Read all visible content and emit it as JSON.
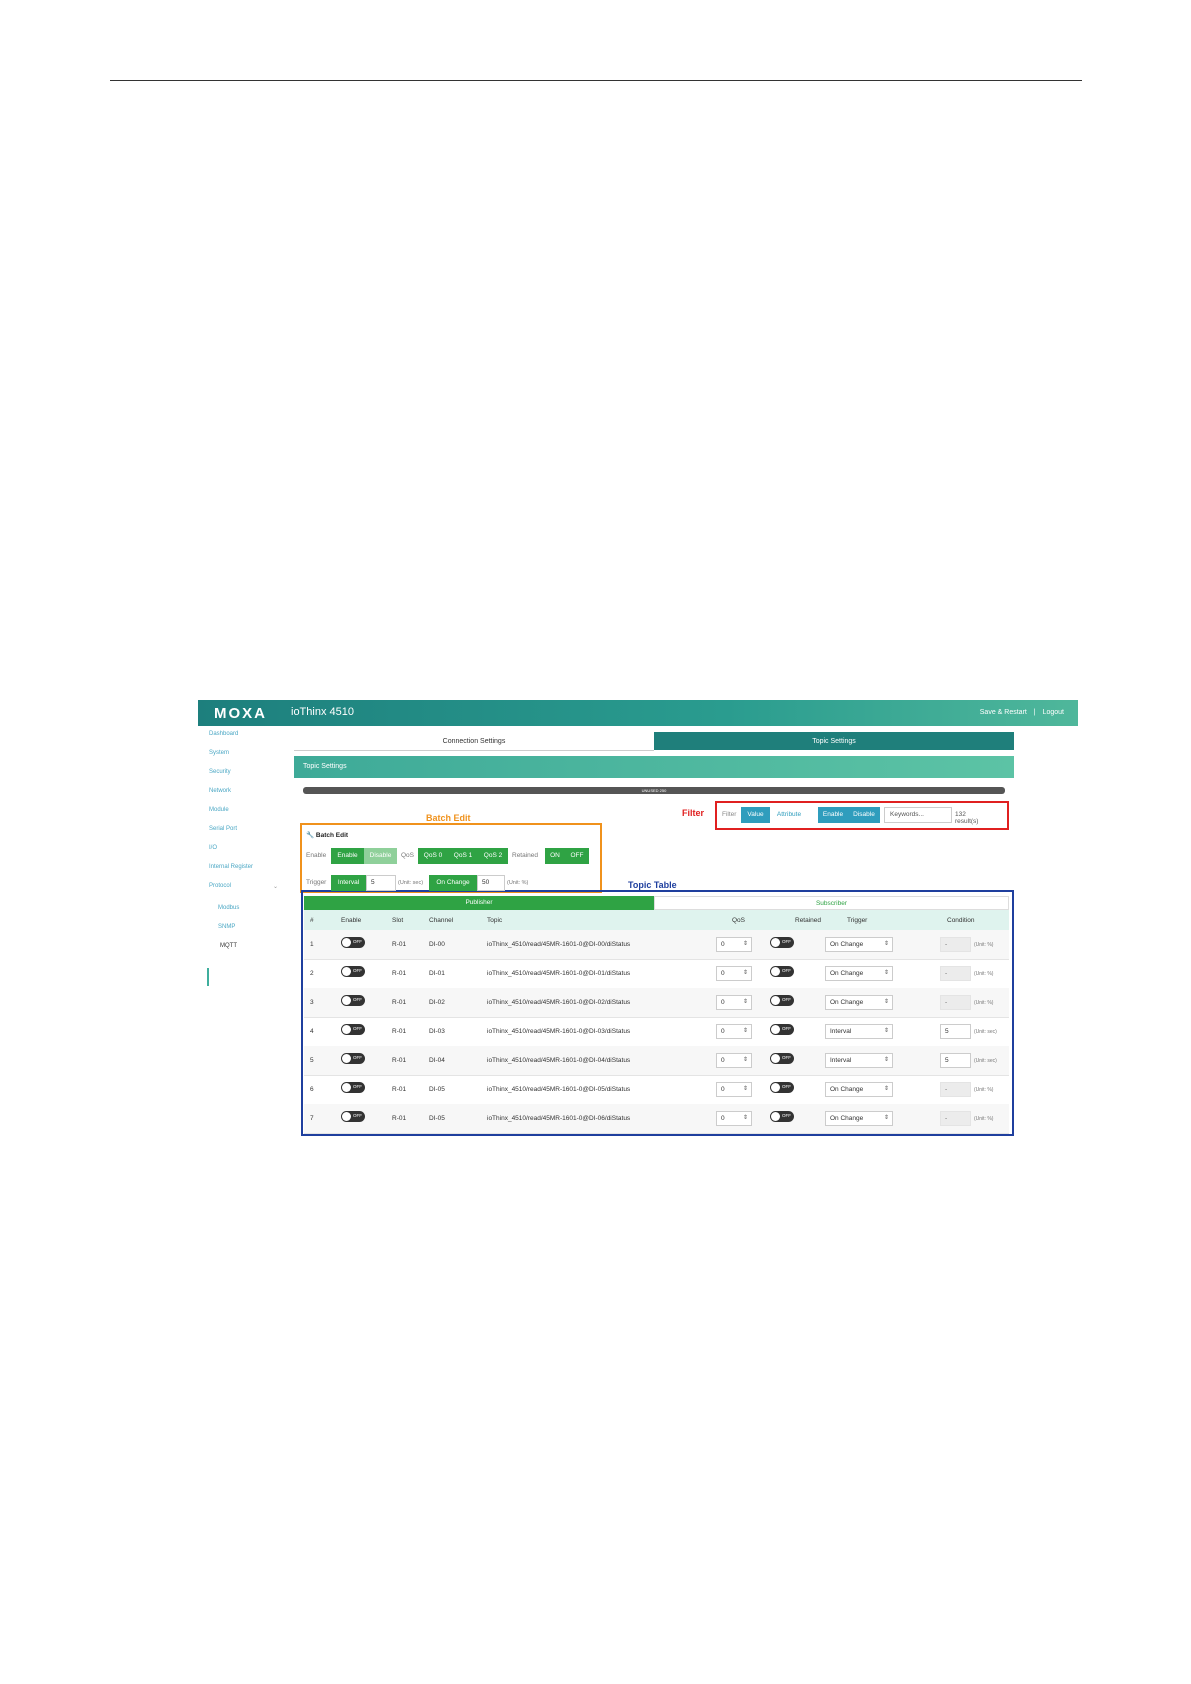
{
  "app": {
    "brand": "MOXA",
    "product": "ioThinx 4510",
    "save_restart": "Save & Restart",
    "separator": "|",
    "logout": "Logout"
  },
  "sidebar": {
    "items": [
      {
        "label": "Dashboard"
      },
      {
        "label": "System"
      },
      {
        "label": "Security"
      },
      {
        "label": "Network"
      },
      {
        "label": "Module"
      },
      {
        "label": "Serial Port"
      },
      {
        "label": "I/O"
      },
      {
        "label": "Internal Register"
      },
      {
        "label": "Protocol"
      }
    ],
    "protocol_chevron": "⌄",
    "sub_items": [
      {
        "label": "Modbus"
      },
      {
        "label": "SNMP"
      },
      {
        "label": "MQTT"
      }
    ],
    "active_item": "MQTT"
  },
  "tabs": {
    "connection": "Connection Settings",
    "topic": "Topic Settings",
    "active": "Topic Settings"
  },
  "section": {
    "title": "Topic Settings"
  },
  "usage": {
    "label": "UNUSED 250",
    "fraction_used": 0.0
  },
  "annotations": {
    "filter": "Filter",
    "batch_edit": "Batch Edit",
    "topic_table": "Topic Table"
  },
  "annotation_colors": {
    "filter": "#e02020",
    "batch_edit": "#f0921c",
    "topic_table": "#1f3f9e"
  },
  "filter": {
    "label": "Filter",
    "value_btn": "Value",
    "attribute_btn": "Attribute",
    "enable_btn": "Enable",
    "disable_btn": "Disable",
    "keyword_placeholder": "Keywords...",
    "results": "132 result(s)"
  },
  "batch_edit": {
    "title": "Batch Edit",
    "icon": "wrench-icon",
    "enable_label": "Enable",
    "enable_btn": "Enable",
    "disable_btn": "Disable",
    "qos_label": "QoS",
    "qos_buttons": [
      "QoS 0",
      "QoS 1",
      "QoS 2"
    ],
    "retained_label": "Retained",
    "retained_on": "ON",
    "retained_off": "OFF",
    "trigger_label": "Trigger",
    "interval_btn": "Interval",
    "interval_value": "5",
    "interval_unit": "(Unit: sec)",
    "onchange_btn": "On Change",
    "onchange_value": "50",
    "onchange_unit": "(Unit: %)"
  },
  "table": {
    "publisher_tab": "Publisher",
    "subscriber_tab": "Subscriber",
    "columns": [
      "#",
      "Enable",
      "Slot",
      "Channel",
      "Topic",
      "QoS",
      "Retained",
      "Trigger",
      "Condition"
    ],
    "rows": [
      {
        "num": "1",
        "enable": "OFF",
        "slot": "R-01",
        "channel": "DI-00",
        "topic": "ioThinx_4510/read/45MR-1601-0@DI-00/diStatus",
        "qos": "0",
        "retained": "OFF",
        "trigger": "On Change",
        "condition": "-",
        "unit": "(Unit: %)"
      },
      {
        "num": "2",
        "enable": "OFF",
        "slot": "R-01",
        "channel": "DI-01",
        "topic": "ioThinx_4510/read/45MR-1601-0@DI-01/diStatus",
        "qos": "0",
        "retained": "OFF",
        "trigger": "On Change",
        "condition": "-",
        "unit": "(Unit: %)"
      },
      {
        "num": "3",
        "enable": "OFF",
        "slot": "R-01",
        "channel": "DI-02",
        "topic": "ioThinx_4510/read/45MR-1601-0@DI-02/diStatus",
        "qos": "0",
        "retained": "OFF",
        "trigger": "On Change",
        "condition": "-",
        "unit": "(Unit: %)"
      },
      {
        "num": "4",
        "enable": "OFF",
        "slot": "R-01",
        "channel": "DI-03",
        "topic": "ioThinx_4510/read/45MR-1601-0@DI-03/diStatus",
        "qos": "0",
        "retained": "OFF",
        "trigger": "Interval",
        "condition": "5",
        "unit": "(Unit: sec)"
      },
      {
        "num": "5",
        "enable": "OFF",
        "slot": "R-01",
        "channel": "DI-04",
        "topic": "ioThinx_4510/read/45MR-1601-0@DI-04/diStatus",
        "qos": "0",
        "retained": "OFF",
        "trigger": "Interval",
        "condition": "5",
        "unit": "(Unit: sec)"
      },
      {
        "num": "6",
        "enable": "OFF",
        "slot": "R-01",
        "channel": "DI-05",
        "topic": "ioThinx_4510/read/45MR-1601-0@DI-05/diStatus",
        "qos": "0",
        "retained": "OFF",
        "trigger": "On Change",
        "condition": "-",
        "unit": "(Unit: %)"
      },
      {
        "num": "7",
        "enable": "OFF",
        "slot": "R-01",
        "channel": "DI-05",
        "topic": "ioThinx_4510/read/45MR-1601-0@DI-06/diStatus",
        "qos": "0",
        "retained": "OFF",
        "trigger": "On Change",
        "condition": "-",
        "unit": "(Unit: %)"
      }
    ]
  },
  "colors": {
    "header_teal": "#1f7f7b",
    "accent_green": "#2fa344",
    "filter_blue": "#2f9dbd"
  }
}
